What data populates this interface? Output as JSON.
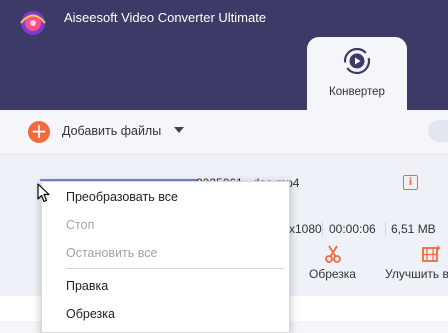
{
  "app": {
    "title": "Aiseesoft Video Converter Ultimate"
  },
  "tabs": [
    {
      "label": "Конвертер",
      "icon": "convert-icon",
      "active": true
    }
  ],
  "toolbar": {
    "add_files_label": "Добавить файлы"
  },
  "file": {
    "name": "...deo.mp4",
    "name_prefix": "2025061",
    "resolution_fragment": "x1080",
    "duration": "00:00:06",
    "size": "6,51 MB"
  },
  "tools": {
    "trim_label": "Обрезка",
    "enhance_label": "Улучшить в"
  },
  "context_menu": {
    "items": [
      {
        "label": "Преобразовать все",
        "enabled": true
      },
      {
        "label": "Стоп",
        "enabled": false
      },
      {
        "label": "Остановить все",
        "enabled": false
      },
      {
        "label": "Правка",
        "enabled": true
      },
      {
        "label": "Обрезка",
        "enabled": true
      }
    ]
  },
  "colors": {
    "titlebar": "#3c3a66",
    "accent": "#f06a3c",
    "progress": "#6f88d8"
  }
}
